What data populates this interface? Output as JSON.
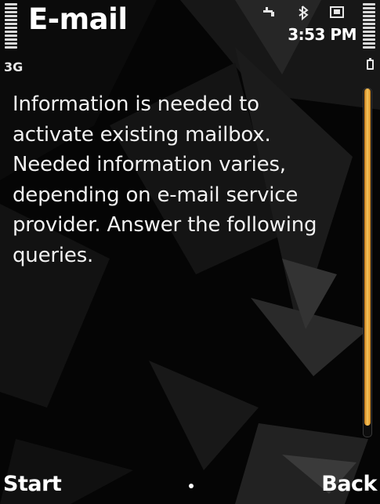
{
  "header": {
    "title": "E-mail",
    "network": "3G",
    "time": "3:53 PM"
  },
  "content": {
    "message_lines": [
      "Information is needed to",
      "activate existing mailbox.",
      "Needed information varies,",
      "depending on e-mail service",
      "provider. Answer the following",
      "queries."
    ]
  },
  "softkeys": {
    "left": "Start",
    "right": "Back"
  },
  "status_icons": [
    "usb-connection-icon",
    "bluetooth-icon",
    "memory-card-icon"
  ],
  "signal_level": 1.0,
  "battery_level": 1.0,
  "scroll_position": 0,
  "colors": {
    "accent": "#f2b443",
    "background": "#000000",
    "text": "#ffffff"
  }
}
